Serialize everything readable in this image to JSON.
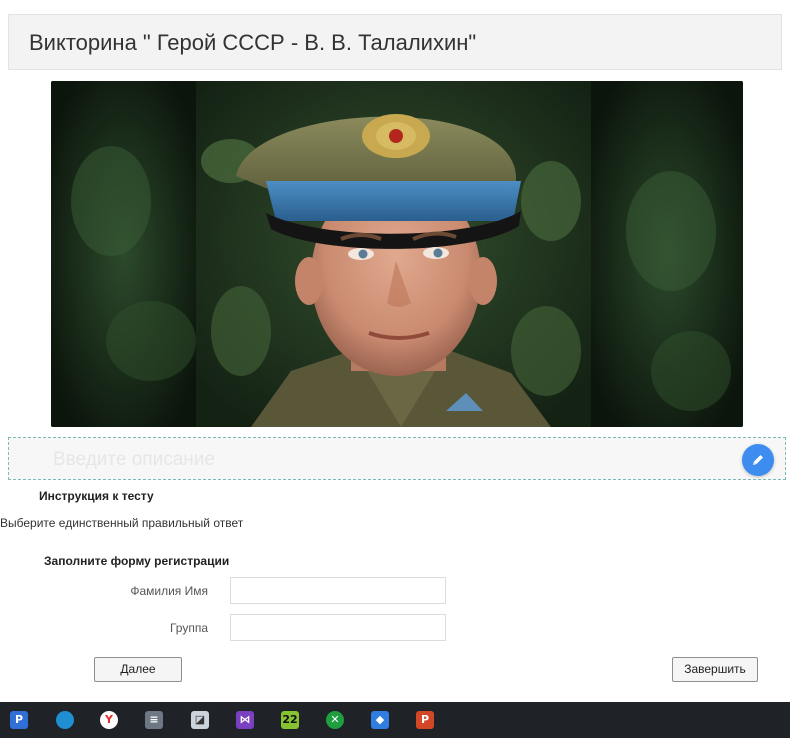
{
  "quiz": {
    "title": "Викторина \" Герой СССР - В. В. Талалихин\"",
    "description_placeholder": "Введите описание"
  },
  "instructions": {
    "title": "Инструкция к тесту",
    "text": "Выберите единственный правильный ответ"
  },
  "registration": {
    "title": "Заполните форму регистрации",
    "fields": [
      {
        "label": "Фамилия Имя",
        "value": ""
      },
      {
        "label": "Группа",
        "value": ""
      }
    ]
  },
  "buttons": {
    "next": "Далее",
    "finish": "Завершить"
  },
  "taskbar": {
    "calendar_badge": "22",
    "apps": [
      "parsec-icon",
      "edge-icon",
      "yandex-browser-icon",
      "calculator-icon",
      "photo-app-icon",
      "visual-studio-icon",
      "calendar-icon",
      "xbox-icon",
      "security-shield-icon",
      "powerpoint-icon"
    ]
  },
  "colors": {
    "accent": "#3d8cf0",
    "header_bg": "#f3f3f3",
    "taskbar_bg": "#1f2227"
  }
}
